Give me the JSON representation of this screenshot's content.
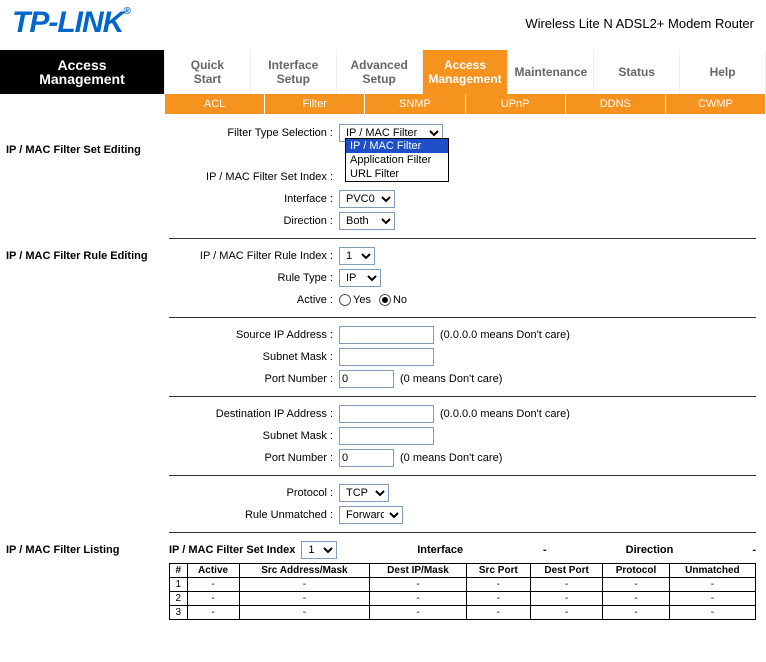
{
  "brand": "TP-LINK",
  "brand_reg": "®",
  "subtitle": "Wireless Lite N ADSL2+ Modem Router",
  "nav": {
    "left_top": "Access",
    "left_bot": "Management",
    "items": [
      {
        "l1": "Quick",
        "l2": "Start"
      },
      {
        "l1": "Interface",
        "l2": "Setup"
      },
      {
        "l1": "Advanced",
        "l2": "Setup"
      },
      {
        "l1": "Access",
        "l2": "Management"
      },
      {
        "l1": "Maintenance",
        "l2": ""
      },
      {
        "l1": "Status",
        "l2": ""
      },
      {
        "l1": "Help",
        "l2": ""
      }
    ]
  },
  "subnav": [
    "ACL",
    "Filter",
    "SNMP",
    "UPnP",
    "DDNS",
    "CWMP"
  ],
  "sidebar": {
    "set_editing": "IP / MAC Filter Set Editing",
    "rule_editing": "IP / MAC Filter Rule Editing",
    "listing": "IP / MAC Filter Listing"
  },
  "labels": {
    "filter_type": "Filter Type Selection :",
    "set_index": "IP / MAC Filter Set Index :",
    "interface": "Interface :",
    "direction": "Direction :",
    "rule_index": "IP / MAC Filter Rule Index :",
    "rule_type": "Rule Type :",
    "active": "Active :",
    "yes": "Yes",
    "no": "No",
    "src_ip": "Source IP Address :",
    "subnet": "Subnet Mask :",
    "port": "Port Number :",
    "dst_ip": "Destination IP Address :",
    "protocol": "Protocol :",
    "unmatched": "Rule Unmatched :",
    "hint_ip": "(0.0.0.0 means Don't care)",
    "hint_port": "(0 means Don't care)"
  },
  "values": {
    "filter_type": "IP / MAC Filter",
    "filter_type_opts": [
      "IP / MAC Filter",
      "Application Filter",
      "URL Filter"
    ],
    "interface": "PVC0",
    "direction": "Both",
    "rule_index": "1",
    "rule_type": "IP",
    "active": "No",
    "src_ip": "",
    "src_mask": "",
    "src_port": "0",
    "dst_ip": "",
    "dst_mask": "",
    "dst_port": "0",
    "protocol": "TCP",
    "unmatched": "Forward"
  },
  "listing": {
    "title": "IP / MAC Filter Set Index",
    "index": "1",
    "interface_label": "Interface",
    "interface_val": "-",
    "direction_label": "Direction",
    "direction_val": "-",
    "headers": [
      "#",
      "Active",
      "Src Address/Mask",
      "Dest IP/Mask",
      "Src Port",
      "Dest Port",
      "Protocol",
      "Unmatched"
    ],
    "rows": [
      [
        "1",
        "-",
        "-",
        "-",
        "-",
        "-",
        "-",
        "-"
      ],
      [
        "2",
        "-",
        "-",
        "-",
        "-",
        "-",
        "-",
        "-"
      ],
      [
        "3",
        "-",
        "-",
        "-",
        "-",
        "-",
        "-",
        "-"
      ]
    ]
  }
}
